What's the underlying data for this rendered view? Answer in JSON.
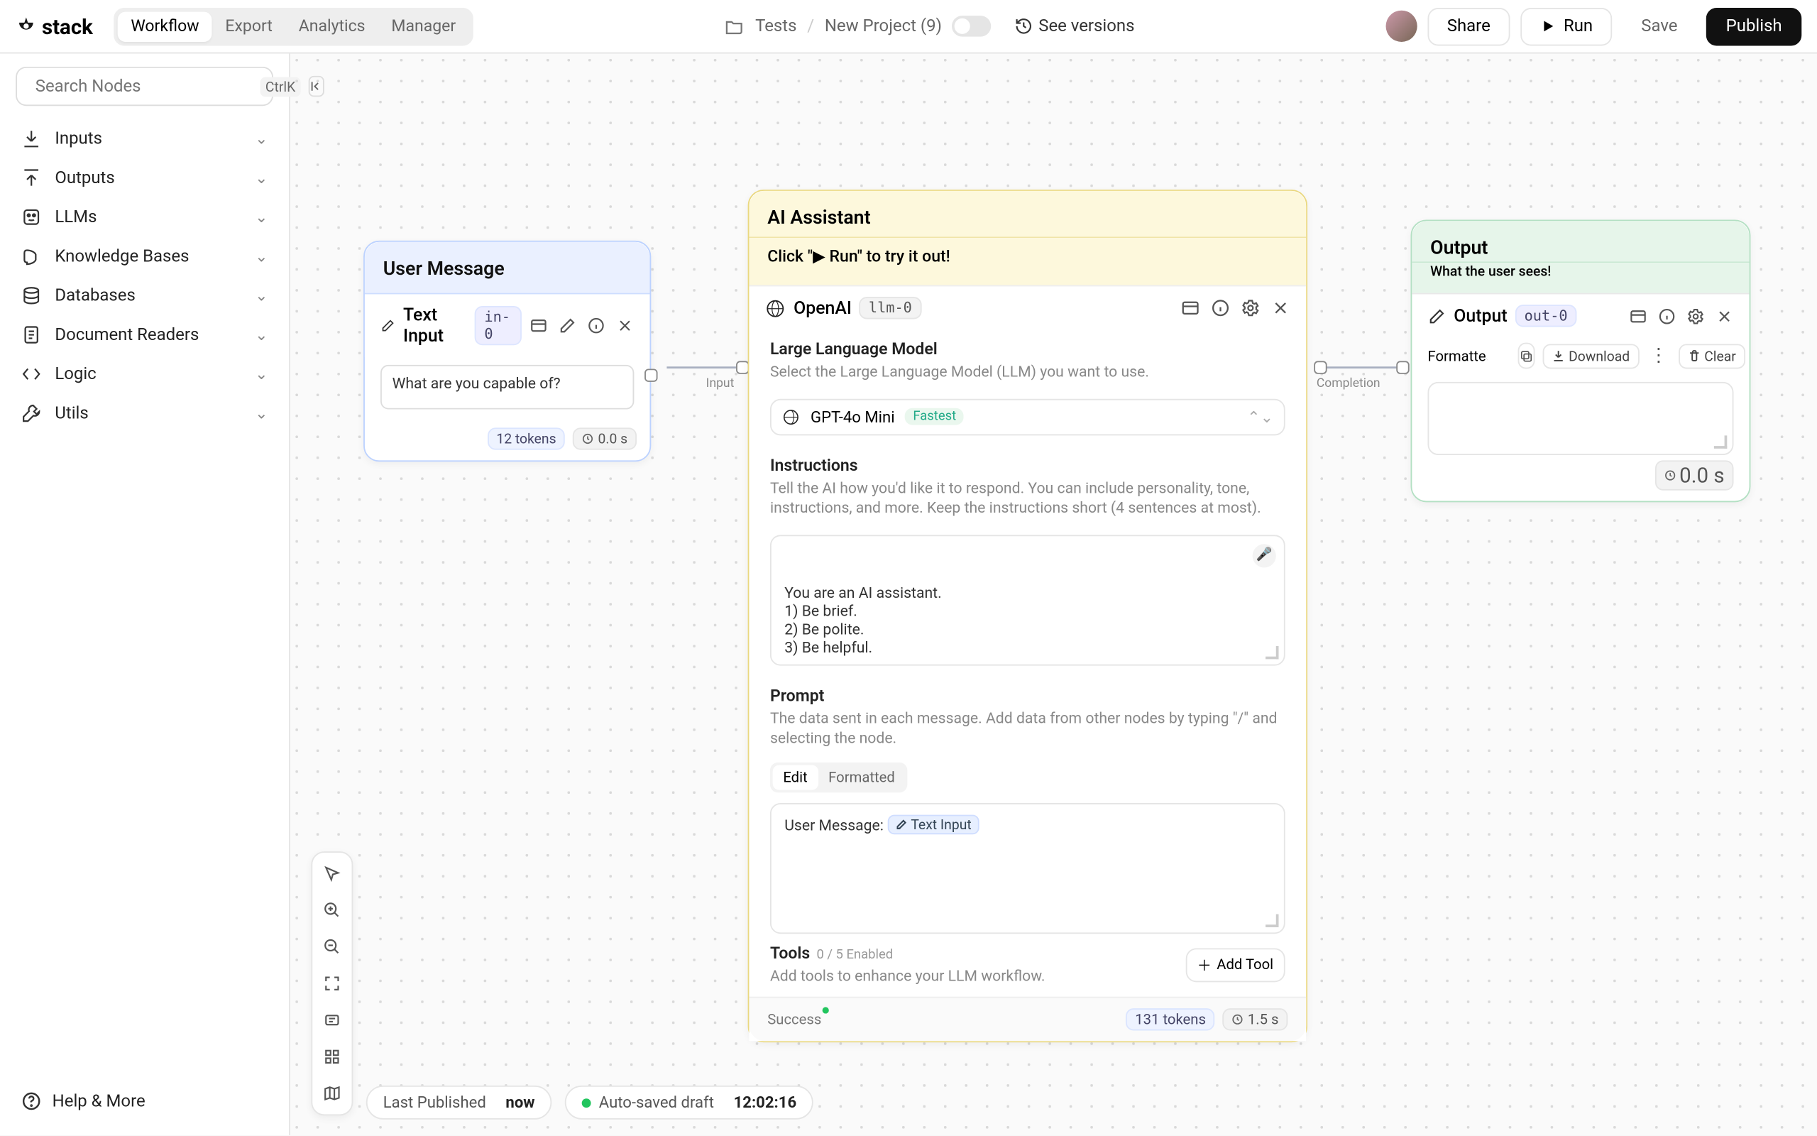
{
  "brand": "stack",
  "tabs": [
    "Workflow",
    "Export",
    "Analytics",
    "Manager"
  ],
  "activeTab": 0,
  "breadcrumb": {
    "folder": "Tests",
    "project": "New Project (9)"
  },
  "versions": "See versions",
  "header": {
    "share": "Share",
    "run": "Run",
    "save": "Save",
    "publish": "Publish"
  },
  "search": {
    "placeholder": "Search Nodes",
    "kbd": "CtrlK"
  },
  "categories": [
    {
      "k": "inputs",
      "label": "Inputs"
    },
    {
      "k": "outputs",
      "label": "Outputs"
    },
    {
      "k": "llms",
      "label": "LLMs"
    },
    {
      "k": "kb",
      "label": "Knowledge Bases"
    },
    {
      "k": "db",
      "label": "Databases"
    },
    {
      "k": "doc",
      "label": "Document Readers"
    },
    {
      "k": "logic",
      "label": "Logic"
    },
    {
      "k": "utils",
      "label": "Utils"
    }
  ],
  "help": "Help & More",
  "status": {
    "pub_label": "Last Published",
    "pub_value": "now",
    "auto_label": "Auto-saved draft",
    "auto_time": "12:02:16"
  },
  "n1": {
    "title": "User Message",
    "node": "Text Input",
    "id": "in-0",
    "value": "What are you capable of?",
    "tokens": "12 tokens",
    "time": "0.0 s",
    "port": "Input"
  },
  "n2": {
    "title": "AI Assistant",
    "sub": "Click \"▶ Run\" to try it out!",
    "node": "OpenAI",
    "id": "llm-0",
    "llm": {
      "title": "Large Language Model",
      "help": "Select the Large Language Model (LLM) you want to use.",
      "model": "GPT-4o Mini",
      "tag": "Fastest"
    },
    "inst": {
      "title": "Instructions",
      "help": "Tell the AI how you'd like it to respond. You can include personality, tone, instructions, and more. Keep the instructions short (4 sentences at most).",
      "value": "You are an AI assistant.\n1) Be brief.\n2) Be polite.\n3) Be helpful."
    },
    "prompt": {
      "title": "Prompt",
      "help": "The data sent in each message. Add data from other nodes by typing \"/\" and selecting the node.",
      "tabs": [
        "Edit",
        "Formatted"
      ],
      "prefix": "User Message: ",
      "chip": "Text Input"
    },
    "tools": {
      "title": "Tools",
      "count": "0 / 5 Enabled",
      "help": "Add tools to enhance your LLM workflow.",
      "add": "Add Tool"
    },
    "footer": {
      "status": "Success",
      "tokens": "131 tokens",
      "time": "1.5 s"
    },
    "port": "Completion"
  },
  "n3": {
    "title": "Output",
    "subtitle": "What the user sees!",
    "node": "Output",
    "id": "out-0",
    "formatted": "Formatted",
    "download": "Download",
    "clear": "Clear",
    "time": "0.0 s"
  }
}
